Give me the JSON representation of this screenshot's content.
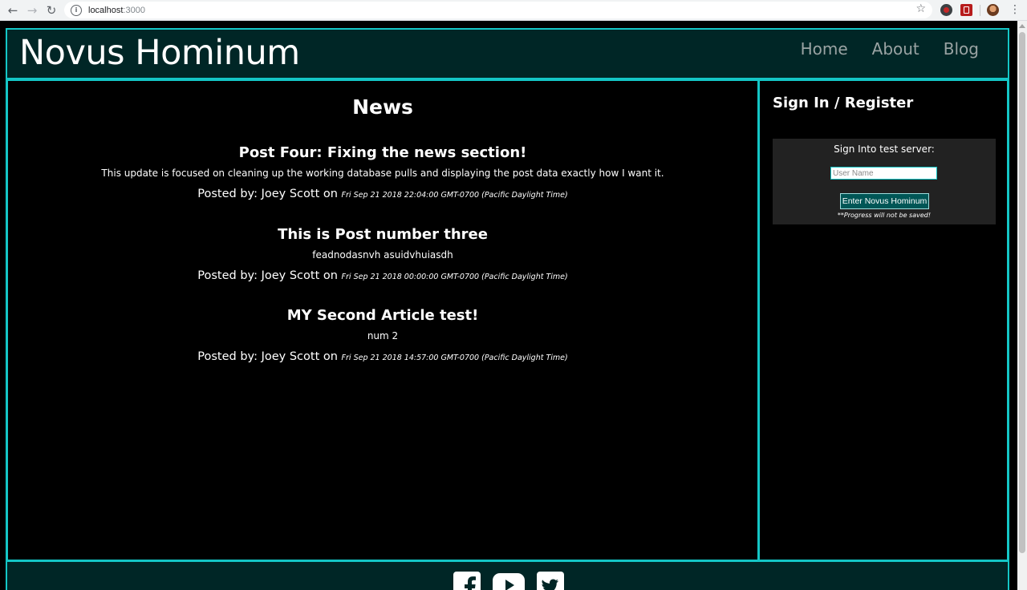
{
  "browser": {
    "url_host": "localhost",
    "url_port": ":3000"
  },
  "header": {
    "title": "Novus Hominum",
    "nav": [
      "Home",
      "About",
      "Blog"
    ]
  },
  "news": {
    "title": "News",
    "posts": [
      {
        "title": "Post Four: Fixing the news section!",
        "body": "This update is focused on cleaning up the working database pulls and displaying the post data exactly how I want it.",
        "posted_by": "Posted by: Joey Scott on",
        "date": "Fri Sep 21 2018 22:04:00 GMT-0700 (Pacific Daylight Time)"
      },
      {
        "title": "This is Post number three",
        "body": "feadnodasnvh asuidvhuiasdh",
        "posted_by": "Posted by: Joey Scott on",
        "date": "Fri Sep 21 2018 00:00:00 GMT-0700 (Pacific Daylight Time)"
      },
      {
        "title": "MY Second Article test!",
        "body": "num 2",
        "posted_by": "Posted by: Joey Scott on",
        "date": "Fri Sep 21 2018 14:57:00 GMT-0700 (Pacific Daylight Time)"
      }
    ]
  },
  "sidebar": {
    "title": "Sign In / Register",
    "signin_label": "Sign Into test server:",
    "username_placeholder": "User Name",
    "username_value": "",
    "enter_button": "Enter Novus Hominum",
    "note": "**Progress will not be saved!"
  },
  "footer": {
    "icons": [
      "facebook-icon",
      "youtube-icon",
      "twitter-icon"
    ]
  },
  "colors": {
    "accent": "#14c6c6",
    "header_bg": "#002626",
    "page_bg": "#000000",
    "button_bg": "#005656"
  }
}
